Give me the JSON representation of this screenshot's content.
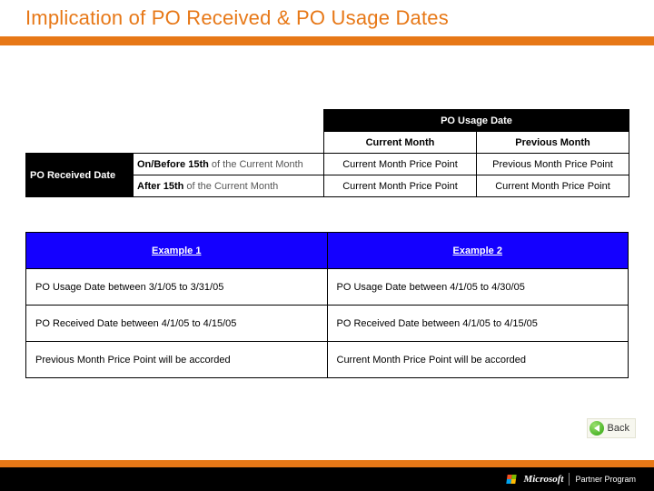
{
  "title": "Implication of PO Received & PO Usage Dates",
  "rules_table": {
    "top_header": "PO Usage Date",
    "sub_header_current": "Current Month",
    "sub_header_previous": "Previous Month",
    "side_header": "PO Received Date",
    "row1_label_bold": "On/Before 15th",
    "row1_label_light": " of the Current Month",
    "row1_current": "Current Month Price Point",
    "row1_previous": "Previous Month Price Point",
    "row2_label_bold": "After 15th",
    "row2_label_light": " of the Current Month",
    "row2_current": "Current Month Price Point",
    "row2_previous": "Current Month Price Point"
  },
  "examples": {
    "header1": "Example 1",
    "header2": "Example 2",
    "rows": {
      "r1c1": "PO Usage Date between 3/1/05 to 3/31/05",
      "r1c2": "PO Usage Date between 4/1/05 to 4/30/05",
      "r2c1": "PO Received Date between 4/1/05 to 4/15/05",
      "r2c2": "PO Received Date between 4/1/05 to 4/15/05",
      "r3c1": "Previous Month Price Point will be accorded",
      "r3c2": "Current Month Price Point will be accorded"
    }
  },
  "back_label": "Back",
  "footer": {
    "brand": "Microsoft",
    "program": "Partner Program"
  }
}
